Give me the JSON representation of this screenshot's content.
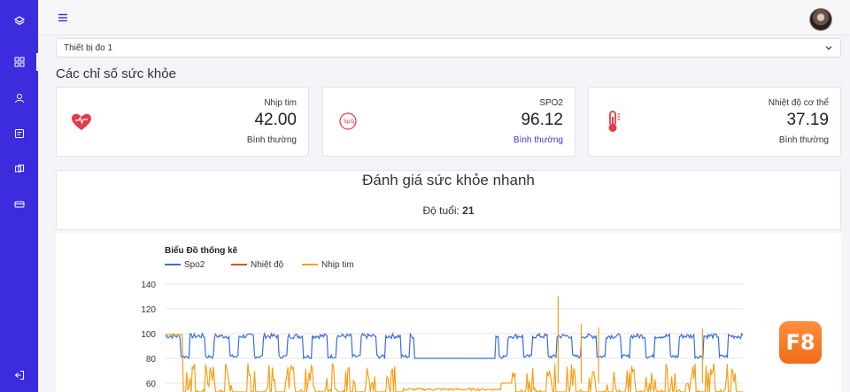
{
  "device_select": {
    "selected": "Thiết bị đo 1"
  },
  "section_title": "Các chỉ số sức khỏe",
  "cards": [
    {
      "label": "Nhịp tim",
      "value": "42.00",
      "status": "Bình thường",
      "icon": "heart-icon"
    },
    {
      "label": "SPO2",
      "value": "96.12",
      "status": "Bình thường",
      "icon": "spo2-icon"
    },
    {
      "label": "Nhiệt độ cơ thể",
      "value": "37.19",
      "status": "Bình thường",
      "icon": "thermometer-icon"
    }
  ],
  "evaluation": {
    "title": "Đánh giá sức khỏe nhanh",
    "age_label": "Độ tuổi:",
    "age_value": "21"
  },
  "colors": {
    "sidebar": "#3d2cde",
    "spo2": "#3a6fd8",
    "temp": "#e8492b",
    "heart": "#f6a019",
    "brand": "#f47a26"
  },
  "brand_logo": "F8",
  "chart_data": {
    "type": "line",
    "title": "Biểu Đồ thống kê",
    "ylim": [
      40,
      140
    ],
    "yticks": [
      140,
      120,
      100,
      80,
      60
    ],
    "grid": true,
    "legend_position": "top-left",
    "series": [
      {
        "name": "Spo2",
        "color": "#3a6fd8",
        "pattern": "spo2"
      },
      {
        "name": "Nhiệt độ",
        "color": "#e8492b",
        "pattern": "flat"
      },
      {
        "name": "Nhịp tim",
        "color": "#f6a019",
        "pattern": "heart"
      }
    ]
  }
}
